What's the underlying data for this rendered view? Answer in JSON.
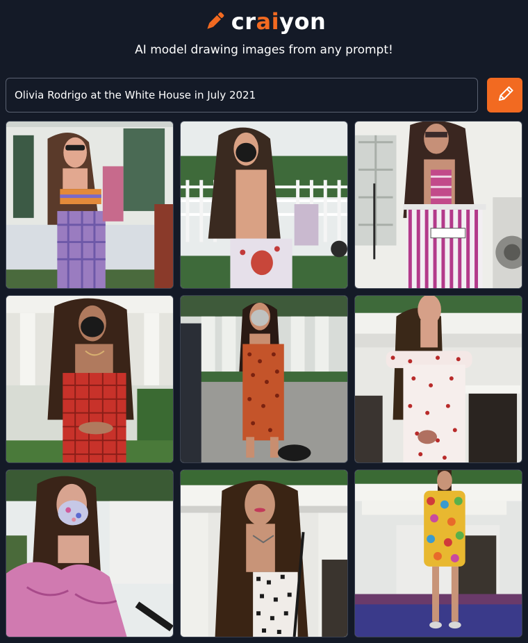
{
  "header": {
    "logo_part1": "cr",
    "logo_part2": "ai",
    "logo_part3": "yon",
    "tagline": "AI model drawing images from any prompt!"
  },
  "prompt": {
    "value": "Olivia Rodrigo at the White House in July 2021"
  },
  "colors": {
    "accent": "#f26a21",
    "background": "#141a27",
    "input_border": "#5b6272"
  },
  "icons": {
    "logo": "pencil-icon",
    "draw_button": "pencil-icon"
  },
  "results": {
    "image_count": 9
  }
}
